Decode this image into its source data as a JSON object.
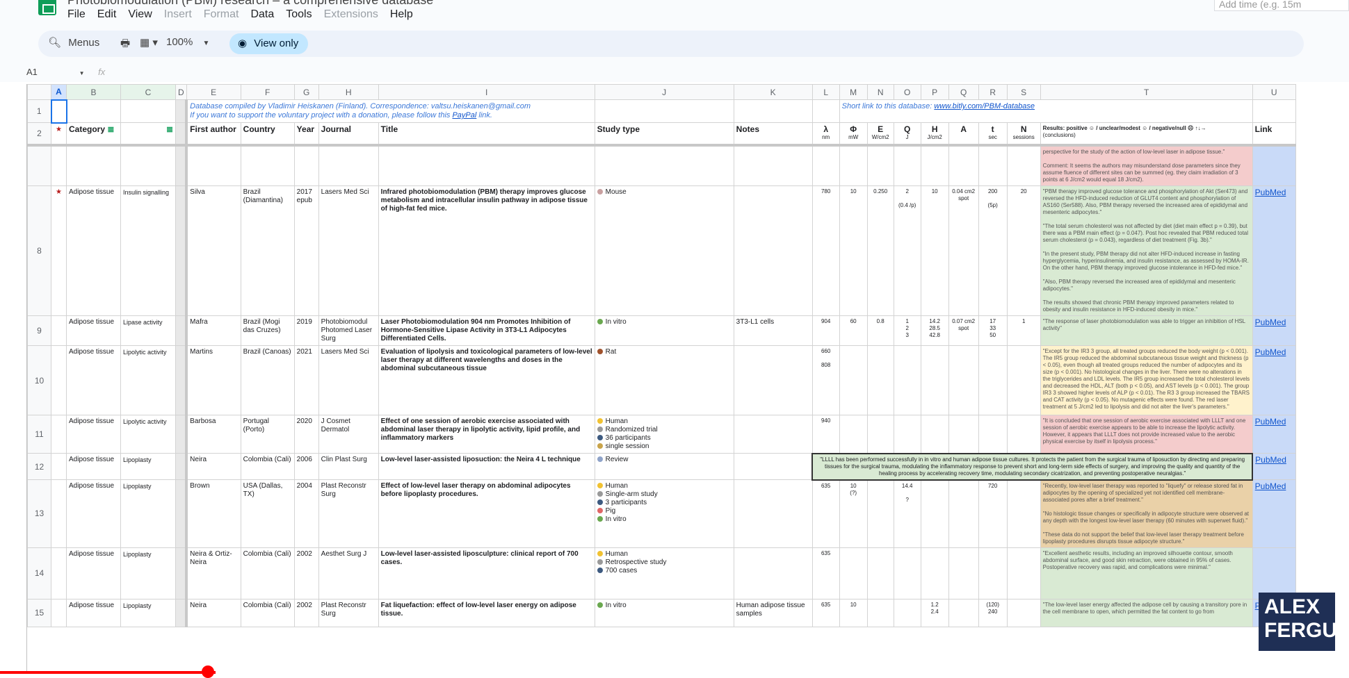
{
  "app": {
    "doc_title": "Photobiomodulation (PBM) research – a comprehensive database",
    "add_time_placeholder": "Add time (e.g. 15m",
    "menu": [
      "File",
      "Edit",
      "View",
      "Insert",
      "Format",
      "Data",
      "Tools",
      "Extensions",
      "Help"
    ],
    "menu_dim": [
      false,
      false,
      false,
      true,
      true,
      false,
      false,
      true,
      false
    ]
  },
  "toolbar": {
    "search_label": "Menus",
    "zoom": "100%",
    "view_only": "View only"
  },
  "formula": {
    "cell_ref": "A1",
    "fx": "fx"
  },
  "columns": [
    "A",
    "B",
    "C",
    "D",
    "E",
    "F",
    "G",
    "H",
    "I",
    "J",
    "K",
    "L",
    "M",
    "N",
    "O",
    "P",
    "Q",
    "R",
    "S",
    "T",
    "U"
  ],
  "row1": {
    "credit_line1": "Database compiled by Vladimir Heiskanen (Finland). Correspondence: valtsu.heiskanen@gmail.com",
    "credit_line2a": "If you want to support the voluntary project with a donation, please follow this ",
    "credit_paypal": "PayPal",
    "credit_line2b": " link.",
    "short_link_label": "Short link to this database: ",
    "short_link": "www.bitly.com/PBM-database"
  },
  "header": {
    "category": "Category",
    "first_author": "First author",
    "country": "Country",
    "year": "Year",
    "journal": "Journal",
    "title": "Title",
    "study_type": "Study type",
    "notes": "Notes",
    "lambda": "λ",
    "lambda_u": "nm",
    "phi": "Φ",
    "phi_u": "mW",
    "e": "E",
    "e_u": "W/cm2",
    "q": "Q",
    "q_u": "J",
    "h": "H",
    "h_u": "J/cm2",
    "a": "A",
    "t": "t",
    "t_u": "sec",
    "n": "N",
    "n_u": "sessions",
    "results": "Results: positive ☺ / unclear/modest ☺ / negative/null ☹ ↑↓→",
    "results_u": "(conclusions)",
    "link": "Link"
  },
  "partial_row": {
    "results": "perspective for the study of the action of low-level laser in adipose tissue.\"\n\nComment: It seems the authors may misunderstand dose parameters since they assume fluence of different sites can be summed (eg. they claim irradiation of 3 points at 6 J/cm2 would equal 18 J/cm2)."
  },
  "rows": [
    {
      "num": "8",
      "star": "★",
      "cat": "Adipose tissue",
      "sub": "Insulin signalling",
      "author": "Silva",
      "country": "Brazil (Diamantina)",
      "year": "2017 epub",
      "journal": "Lasers Med Sci",
      "title": "Infrared photobiomodulation (PBM) therapy improves glucose metabolism and intracellular insulin pathway in adipose tissue of high-fat fed mice.",
      "study": [
        "Mouse"
      ],
      "notes": "",
      "l": "780",
      "m": "10",
      "n": "0.250",
      "o": "2\n\n(0.4 /p)",
      "p": "10",
      "q": "0.04 cm2 spot",
      "r": "200\n\n(5p)",
      "s": "20",
      "results": "\"PBM therapy improved glucose tolerance and phosphorylation of Akt (Ser473) and reversed the HFD-induced reduction of GLUT4 content and phosphorylation of AS160 (Ser588). Also, PBM therapy reversed the increased area of epididymal and mesenteric adipocytes.\"\n\n\"The total serum cholesterol was not affected by diet (diet main effect p = 0.39), but there was a PBM main effect (p = 0.047). Post hoc revealed that PBM reduced total serum cholesterol (p = 0.043), regardless of diet treatment (Fig. 3b).\"\n\n\"In the present study, PBM therapy did not alter HFD-induced increase in fasting hyperglycemia, hyperinsulinemia, and insulin resistance, as assessed by HOMA-IR. On the other hand, PBM therapy improved glucose intolerance in HFD-fed mice.\"\n\n\"Also, PBM therapy reversed the increased area of epididymal and mesenteric adipocytes.\"\n\nThe results showed that chronic PBM therapy improved parameters related to obesity and insulin resistance in HFD-induced obesity in mice.\"",
      "res_class": "res-green",
      "link": "PubMed",
      "h": 176
    },
    {
      "num": "9",
      "star": "",
      "cat": "Adipose tissue",
      "sub": "Lipase activity",
      "author": "Mafra",
      "country": "Brazil (Mogi das Cruzes)",
      "year": "2019",
      "journal": "Photobiomodul Photomed Laser Surg",
      "title": "Laser Photobiomodulation 904 nm Promotes Inhibition of Hormone-Sensitive Lipase Activity in 3T3-L1 Adipocytes Differentiated Cells.",
      "study": [
        "In vitro"
      ],
      "notes": "3T3-L1 cells",
      "l": "904",
      "m": "60",
      "n": "0.8",
      "o": "1\n2\n3",
      "p": "14.2\n28.5\n42.8",
      "q": "0.07 cm2 spot",
      "r": "17\n33\n50",
      "s": "1",
      "results": "\"The response of laser photobiomodulation was able to trigger an inhibition of HSL activity\"",
      "res_class": "res-green",
      "link": "PubMed",
      "h": 38
    },
    {
      "num": "10",
      "star": "",
      "cat": "Adipose tissue",
      "sub": "Lipolytic activity",
      "author": "Martins",
      "country": "Brazil (Canoas)",
      "year": "2021",
      "journal": "Lasers Med Sci",
      "title": "Evaluation of lipolysis and toxicological parameters of low-level laser therapy at different wavelengths and doses in the abdominal subcutaneous tissue",
      "study": [
        "Rat"
      ],
      "notes": "",
      "l": "660\n\n808",
      "m": "",
      "n": "",
      "o": "",
      "p": "",
      "q": "",
      "r": "",
      "s": "",
      "results": "\"Except for the IR3 3 group, all treated groups reduced the body weight (p < 0.001). The IR5 group reduced the abdominal subcutaneous tissue weight and thickness (p < 0.05), even though all treated groups reduced the number of adipocytes and its size (p < 0.001). No histological changes in the liver. There were no alterations in the triglycerides and LDL levels. The IR5 group increased the total cholesterol levels and decreased the HDL, ALT (both p < 0.05), and AST levels (p < 0.001). The group IR3 3 showed higher levels of ALP (p < 0.01). The R3 3 group increased the TBARS and CAT activity (p < 0.05). No mutagenic effects were found. The red laser treatment at 5 J/cm2 led to lipolysis and did not alter the liver's parameters.\"",
      "res_class": "res-yellow",
      "link": "PubMed",
      "h": 100
    },
    {
      "num": "11",
      "star": "",
      "cat": "Adipose tissue",
      "sub": "Lipolytic activity",
      "author": "Barbosa",
      "country": "Portugal (Porto)",
      "year": "2020",
      "journal": "J Cosmet Dermatol",
      "title": "Effect of one session of aerobic exercise associated with abdominal laser therapy in lipolytic activity, lipid profile, and inflammatory markers",
      "study": [
        "Human",
        "Randomized trial",
        "36 participants",
        "single session"
      ],
      "notes": "",
      "l": "940",
      "m": "",
      "n": "",
      "o": "",
      "p": "",
      "q": "",
      "r": "",
      "s": "",
      "results": "\"It is concluded that one session of aerobic exercise associated with LLLT and one session of aerobic exercise appears to be able to increase the lipolytic activity. However, it appears that LLLT does not provide increased value to the aerobic physical exercise by itself in lipolysis process.\"",
      "res_class": "res-red",
      "link": "PubMed",
      "h": 50
    },
    {
      "num": "12",
      "star": "",
      "cat": "Adipose tissue",
      "sub": "Lipoplasty",
      "author": "Neira",
      "country": "Colombia (Cali)",
      "year": "2006",
      "journal": "Clin Plast Surg",
      "title": "Low-level laser-assisted liposuction: the Neira 4 L technique",
      "study": [
        "Review"
      ],
      "notes": "",
      "span_text": "\"LLLL has been performed successfully in in vitro and human adipose tissue cultures. It protects the patient from the surgical trauma of liposuction by directing and preparing tissues for the surgical trauma, modulating the inflammatory response to prevent short and long-term side effects of surgery, and improving the quality and quantity of the healing process by accelerating recovery time, modulating secondary cicatrization, and preventing postoperative neuralgias.\"",
      "res_class": "res-green",
      "link": "PubMed",
      "h": 33
    },
    {
      "num": "13",
      "star": "",
      "cat": "Adipose tissue",
      "sub": "Lipoplasty",
      "author": "Brown",
      "country": "USA (Dallas, TX)",
      "year": "2004",
      "journal": "Plast Reconstr Surg",
      "title": "Effect of low-level laser therapy on abdominal adipocytes before lipoplasty procedures.",
      "study": [
        "Human",
        "Single-arm study",
        "3 participants",
        "Pig",
        "In vitro"
      ],
      "notes": "",
      "l": "635",
      "m": "10\n(?)",
      "n": "",
      "o": "14.4\n\n?",
      "p": "",
      "q": "",
      "r": "720",
      "s": "",
      "results": "\"Recently, low-level laser therapy was reported to \"liquefy\" or release stored fat in adipocytes by the opening of specialized yet not identified cell membrane-associated pores after a brief treatment.\"\n\n\"No histologic tissue changes or specifically in adipocyte structure were observed at any depth with the longest low-level laser therapy (60 minutes with superwet fluid).\"\n\n\"These data do not support the belief that low-level laser therapy treatment before lipoplasty procedures disrupts tissue adipocyte structure.\"",
      "res_class": "res-olive",
      "link": "PubMed",
      "h": 89
    },
    {
      "num": "14",
      "star": "",
      "cat": "Adipose tissue",
      "sub": "Lipoplasty",
      "author": "Neira & Ortiz-Neira",
      "country": "Colombia (Cali)",
      "year": "2002",
      "journal": "Aesthet Surg J",
      "title": "Low-level laser-assisted liposculpture: clinical report of 700 cases.",
      "study": [
        "Human",
        "Retrospective study",
        "700 cases"
      ],
      "notes": "",
      "l": "635",
      "m": "",
      "n": "",
      "o": "",
      "p": "",
      "q": "",
      "r": "",
      "s": "",
      "results": "\"Excellent aesthetic results, including an improved silhouette contour, smooth abdominal surface, and good skin retraction, were obtained in 95% of cases. Postoperative recovery was rapid, and complications were minimal.\"",
      "res_class": "res-green",
      "link": "",
      "h": 74
    },
    {
      "num": "15",
      "star": "",
      "cat": "Adipose tissue",
      "sub": "Lipoplasty",
      "author": "Neira",
      "country": "Colombia (Cali)",
      "year": "2002",
      "journal": "Plast Reconstr Surg",
      "title": "Fat liquefaction: effect of low-level laser energy on adipose tissue.",
      "study": [
        "In vitro"
      ],
      "notes": "Human adipose tissue samples",
      "l": "635",
      "m": "10",
      "n": "",
      "o": "",
      "p": "1.2\n2.4",
      "q": "",
      "r": "(120)\n240",
      "s": "",
      "results": "\"The low-level laser energy affected the adipose cell by causing a transitory pore in the cell membrane to open, which permitted the fat content to go from",
      "res_class": "res-green",
      "link": "PubMed",
      "h": 40
    }
  ],
  "study_icon_colors": {
    "Mouse": "#c9a0a0",
    "In vitro": "#6aa84f",
    "Rat": "#a0522d",
    "Human": "#f1c232",
    "Randomized trial": "#999999",
    "36 participants": "#3d5a80",
    "single session": "#c9a44a",
    "Review": "#8fa3c9",
    "Single-arm study": "#999999",
    "3 participants": "#3d5a80",
    "Pig": "#e06666",
    "Retrospective study": "#999999",
    "700 cases": "#3d5a80"
  },
  "overlay": {
    "logo_line1": "ALEX",
    "logo_line2": "FERGUS"
  }
}
